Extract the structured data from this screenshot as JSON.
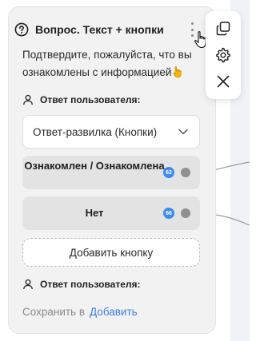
{
  "node": {
    "title": "Вопрос. Текст + кнопки",
    "message": "Подтвердите, пожалуйста, что вы ознакомлены с информацией",
    "answer_label_top": "Ответ пользователя:",
    "answer_type": "Ответ-развилка (Кнопки)",
    "options": [
      {
        "label": "Ознакомлен / Ознакомлена",
        "badge": "62"
      },
      {
        "label": "Нет",
        "badge": "66"
      }
    ],
    "add_button_label": "Добавить кнопку",
    "answer_label_bottom": "Ответ пользователя:",
    "save_label": "Сохранить в",
    "save_link": "Добавить"
  },
  "toolbar": {
    "icons": [
      "copy-icon",
      "gear-icon",
      "close-icon"
    ]
  },
  "colors": {
    "accent": "#3d7fe0",
    "badge": "#3d8bf0",
    "card_bg": "#f2f2f2",
    "option_bg": "#e3e3e3",
    "canvas_bg": "#f0f2f8"
  }
}
